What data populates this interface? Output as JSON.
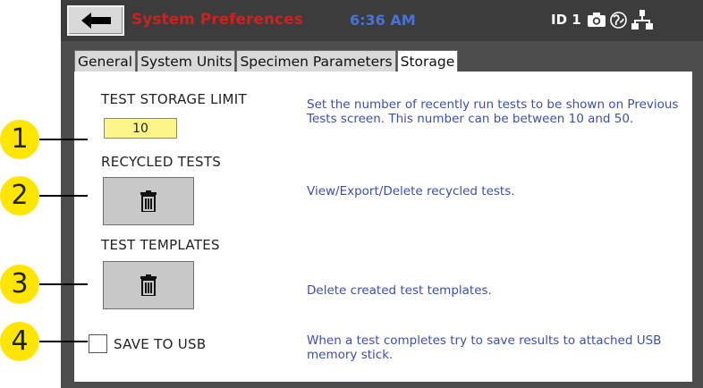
{
  "titlebar": {
    "title": "System Preferences",
    "time": "6:36 AM",
    "id_label": "ID 1",
    "icons": [
      "arrow-left-icon",
      "camera-icon",
      "globe-icon",
      "network-icon"
    ]
  },
  "tabs": [
    {
      "label": "General",
      "active": false
    },
    {
      "label": "System Units",
      "active": false
    },
    {
      "label": "Specimen Parameters",
      "active": false
    },
    {
      "label": "Storage",
      "active": true
    }
  ],
  "storage": {
    "test_storage_limit_label": "TEST STORAGE LIMIT",
    "test_storage_limit_value": "10",
    "test_storage_limit_desc": "Set the number of recently run tests to be shown on Previous Tests screen. This number can be between 10 and 50.",
    "recycled_tests_label": "RECYCLED TESTS",
    "recycled_tests_desc": "View/Export/Delete recycled tests.",
    "test_templates_label": "TEST TEMPLATES",
    "test_templates_desc": "Delete created test templates.",
    "save_to_usb_label": "SAVE TO USB",
    "save_to_usb_checked": false,
    "save_to_usb_desc": "When a test completes try to save results to attached USB memory stick."
  },
  "callouts": [
    "1",
    "2",
    "3",
    "4"
  ],
  "colors": {
    "title_red": "#cc2222",
    "clock_blue": "#4a73d6",
    "description_blue": "#3d4fa8",
    "input_yellow": "#fdf58a",
    "callout_yellow": "#ffe600",
    "bezel": "#4d4d4d"
  }
}
